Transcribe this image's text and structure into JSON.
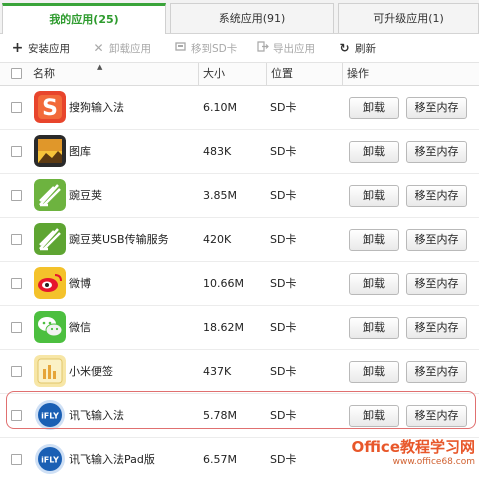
{
  "tabs": [
    {
      "label": "我的应用(25)",
      "active": true
    },
    {
      "label": "系统应用(91)",
      "active": false
    },
    {
      "label": "可升级应用(1)",
      "active": false
    }
  ],
  "toolbar": {
    "install": "安装应用",
    "uninstall": "卸载应用",
    "move_sd": "移到SD卡",
    "export": "导出应用",
    "refresh": "刷新"
  },
  "table": {
    "headers": {
      "name": "名称",
      "size": "大小",
      "location": "位置",
      "action": "操作"
    },
    "uninstall_label": "卸载",
    "move_label": "移至内存",
    "rows": [
      {
        "name": "搜狗输入法",
        "size": "6.10M",
        "location": "SD卡",
        "icon": "sogou-icon"
      },
      {
        "name": "图库",
        "size": "483K",
        "location": "SD卡",
        "icon": "gallery-icon"
      },
      {
        "name": "豌豆荚",
        "size": "3.85M",
        "location": "SD卡",
        "icon": "wandoujia-icon"
      },
      {
        "name": "豌豆荚USB传输服务",
        "size": "420K",
        "location": "SD卡",
        "icon": "wandoujia-usb-icon"
      },
      {
        "name": "微博",
        "size": "10.66M",
        "location": "SD卡",
        "icon": "weibo-icon"
      },
      {
        "name": "微信",
        "size": "18.62M",
        "location": "SD卡",
        "icon": "wechat-icon"
      },
      {
        "name": "小米便签",
        "size": "437K",
        "location": "SD卡",
        "icon": "mi-notes-icon"
      },
      {
        "name": "讯飞输入法",
        "size": "5.78M",
        "location": "SD卡",
        "icon": "iflytek-icon"
      },
      {
        "name": "讯飞输入法Pad版",
        "size": "6.57M",
        "location": "SD卡",
        "icon": "iflytek-pad-icon"
      }
    ]
  },
  "watermark": {
    "main": "Office教程学习网",
    "sub": "www.office68.com"
  },
  "colors": {
    "accent": "#3aa43a",
    "highlight": "#e07070"
  }
}
